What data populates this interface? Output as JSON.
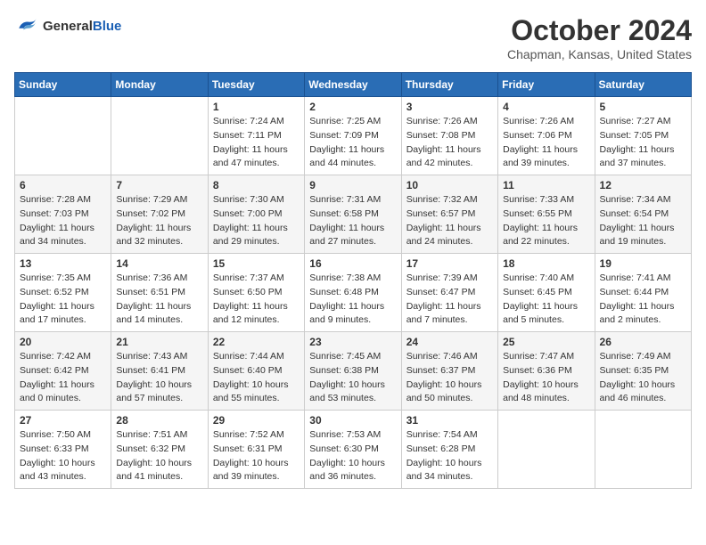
{
  "header": {
    "logo_line1": "General",
    "logo_line2": "Blue",
    "month": "October 2024",
    "location": "Chapman, Kansas, United States"
  },
  "days_of_week": [
    "Sunday",
    "Monday",
    "Tuesday",
    "Wednesday",
    "Thursday",
    "Friday",
    "Saturday"
  ],
  "weeks": [
    [
      {
        "num": "",
        "sunrise": "",
        "sunset": "",
        "daylight": ""
      },
      {
        "num": "",
        "sunrise": "",
        "sunset": "",
        "daylight": ""
      },
      {
        "num": "1",
        "sunrise": "Sunrise: 7:24 AM",
        "sunset": "Sunset: 7:11 PM",
        "daylight": "Daylight: 11 hours and 47 minutes."
      },
      {
        "num": "2",
        "sunrise": "Sunrise: 7:25 AM",
        "sunset": "Sunset: 7:09 PM",
        "daylight": "Daylight: 11 hours and 44 minutes."
      },
      {
        "num": "3",
        "sunrise": "Sunrise: 7:26 AM",
        "sunset": "Sunset: 7:08 PM",
        "daylight": "Daylight: 11 hours and 42 minutes."
      },
      {
        "num": "4",
        "sunrise": "Sunrise: 7:26 AM",
        "sunset": "Sunset: 7:06 PM",
        "daylight": "Daylight: 11 hours and 39 minutes."
      },
      {
        "num": "5",
        "sunrise": "Sunrise: 7:27 AM",
        "sunset": "Sunset: 7:05 PM",
        "daylight": "Daylight: 11 hours and 37 minutes."
      }
    ],
    [
      {
        "num": "6",
        "sunrise": "Sunrise: 7:28 AM",
        "sunset": "Sunset: 7:03 PM",
        "daylight": "Daylight: 11 hours and 34 minutes."
      },
      {
        "num": "7",
        "sunrise": "Sunrise: 7:29 AM",
        "sunset": "Sunset: 7:02 PM",
        "daylight": "Daylight: 11 hours and 32 minutes."
      },
      {
        "num": "8",
        "sunrise": "Sunrise: 7:30 AM",
        "sunset": "Sunset: 7:00 PM",
        "daylight": "Daylight: 11 hours and 29 minutes."
      },
      {
        "num": "9",
        "sunrise": "Sunrise: 7:31 AM",
        "sunset": "Sunset: 6:58 PM",
        "daylight": "Daylight: 11 hours and 27 minutes."
      },
      {
        "num": "10",
        "sunrise": "Sunrise: 7:32 AM",
        "sunset": "Sunset: 6:57 PM",
        "daylight": "Daylight: 11 hours and 24 minutes."
      },
      {
        "num": "11",
        "sunrise": "Sunrise: 7:33 AM",
        "sunset": "Sunset: 6:55 PM",
        "daylight": "Daylight: 11 hours and 22 minutes."
      },
      {
        "num": "12",
        "sunrise": "Sunrise: 7:34 AM",
        "sunset": "Sunset: 6:54 PM",
        "daylight": "Daylight: 11 hours and 19 minutes."
      }
    ],
    [
      {
        "num": "13",
        "sunrise": "Sunrise: 7:35 AM",
        "sunset": "Sunset: 6:52 PM",
        "daylight": "Daylight: 11 hours and 17 minutes."
      },
      {
        "num": "14",
        "sunrise": "Sunrise: 7:36 AM",
        "sunset": "Sunset: 6:51 PM",
        "daylight": "Daylight: 11 hours and 14 minutes."
      },
      {
        "num": "15",
        "sunrise": "Sunrise: 7:37 AM",
        "sunset": "Sunset: 6:50 PM",
        "daylight": "Daylight: 11 hours and 12 minutes."
      },
      {
        "num": "16",
        "sunrise": "Sunrise: 7:38 AM",
        "sunset": "Sunset: 6:48 PM",
        "daylight": "Daylight: 11 hours and 9 minutes."
      },
      {
        "num": "17",
        "sunrise": "Sunrise: 7:39 AM",
        "sunset": "Sunset: 6:47 PM",
        "daylight": "Daylight: 11 hours and 7 minutes."
      },
      {
        "num": "18",
        "sunrise": "Sunrise: 7:40 AM",
        "sunset": "Sunset: 6:45 PM",
        "daylight": "Daylight: 11 hours and 5 minutes."
      },
      {
        "num": "19",
        "sunrise": "Sunrise: 7:41 AM",
        "sunset": "Sunset: 6:44 PM",
        "daylight": "Daylight: 11 hours and 2 minutes."
      }
    ],
    [
      {
        "num": "20",
        "sunrise": "Sunrise: 7:42 AM",
        "sunset": "Sunset: 6:42 PM",
        "daylight": "Daylight: 11 hours and 0 minutes."
      },
      {
        "num": "21",
        "sunrise": "Sunrise: 7:43 AM",
        "sunset": "Sunset: 6:41 PM",
        "daylight": "Daylight: 10 hours and 57 minutes."
      },
      {
        "num": "22",
        "sunrise": "Sunrise: 7:44 AM",
        "sunset": "Sunset: 6:40 PM",
        "daylight": "Daylight: 10 hours and 55 minutes."
      },
      {
        "num": "23",
        "sunrise": "Sunrise: 7:45 AM",
        "sunset": "Sunset: 6:38 PM",
        "daylight": "Daylight: 10 hours and 53 minutes."
      },
      {
        "num": "24",
        "sunrise": "Sunrise: 7:46 AM",
        "sunset": "Sunset: 6:37 PM",
        "daylight": "Daylight: 10 hours and 50 minutes."
      },
      {
        "num": "25",
        "sunrise": "Sunrise: 7:47 AM",
        "sunset": "Sunset: 6:36 PM",
        "daylight": "Daylight: 10 hours and 48 minutes."
      },
      {
        "num": "26",
        "sunrise": "Sunrise: 7:49 AM",
        "sunset": "Sunset: 6:35 PM",
        "daylight": "Daylight: 10 hours and 46 minutes."
      }
    ],
    [
      {
        "num": "27",
        "sunrise": "Sunrise: 7:50 AM",
        "sunset": "Sunset: 6:33 PM",
        "daylight": "Daylight: 10 hours and 43 minutes."
      },
      {
        "num": "28",
        "sunrise": "Sunrise: 7:51 AM",
        "sunset": "Sunset: 6:32 PM",
        "daylight": "Daylight: 10 hours and 41 minutes."
      },
      {
        "num": "29",
        "sunrise": "Sunrise: 7:52 AM",
        "sunset": "Sunset: 6:31 PM",
        "daylight": "Daylight: 10 hours and 39 minutes."
      },
      {
        "num": "30",
        "sunrise": "Sunrise: 7:53 AM",
        "sunset": "Sunset: 6:30 PM",
        "daylight": "Daylight: 10 hours and 36 minutes."
      },
      {
        "num": "31",
        "sunrise": "Sunrise: 7:54 AM",
        "sunset": "Sunset: 6:28 PM",
        "daylight": "Daylight: 10 hours and 34 minutes."
      },
      {
        "num": "",
        "sunrise": "",
        "sunset": "",
        "daylight": ""
      },
      {
        "num": "",
        "sunrise": "",
        "sunset": "",
        "daylight": ""
      }
    ]
  ]
}
